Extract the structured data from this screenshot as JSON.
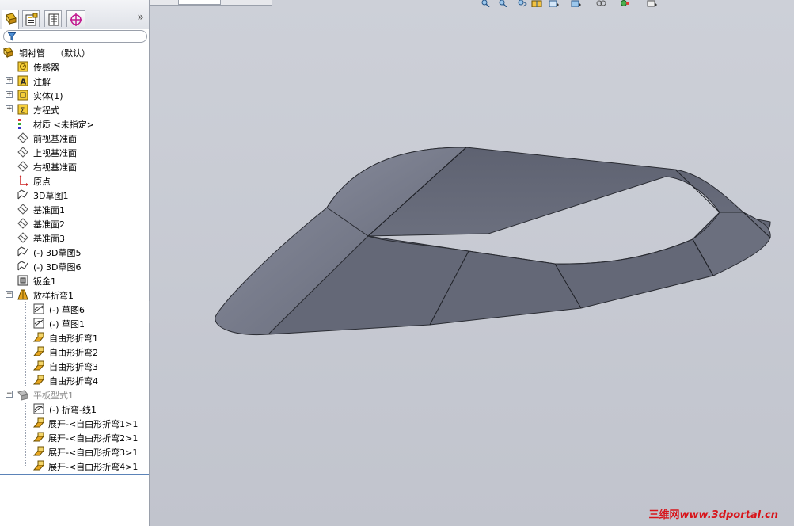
{
  "panel": {
    "tabs": [
      {
        "icon": "feature-manager-icon"
      },
      {
        "icon": "property-manager-icon"
      },
      {
        "icon": "configuration-manager-icon"
      },
      {
        "icon": "dimxpert-manager-icon"
      }
    ],
    "expand": "»"
  },
  "tree": {
    "root": {
      "name": "钢衬管",
      "config": "（默认）"
    },
    "items": [
      {
        "label": "传感器",
        "icon": "sensors-icon"
      },
      {
        "label": "注解",
        "icon": "annotations-icon"
      },
      {
        "label": "实体(1)",
        "icon": "solid-bodies-icon"
      },
      {
        "label": "方程式",
        "icon": "equations-icon"
      },
      {
        "label": "材质 <未指定>",
        "icon": "material-icon"
      },
      {
        "label": "前视基准面",
        "icon": "plane-icon"
      },
      {
        "label": "上视基准面",
        "icon": "plane-icon"
      },
      {
        "label": "右视基准面",
        "icon": "plane-icon"
      },
      {
        "label": "原点",
        "icon": "origin-icon"
      },
      {
        "label": "3D草图1",
        "icon": "sketch-3d-icon"
      },
      {
        "label": "基准面1",
        "icon": "plane-icon"
      },
      {
        "label": "基准面2",
        "icon": "plane-icon"
      },
      {
        "label": "基准面3",
        "icon": "plane-icon"
      },
      {
        "label": "(-) 3D草图5",
        "icon": "sketch-3d-icon"
      },
      {
        "label": "(-) 3D草图6",
        "icon": "sketch-3d-icon"
      },
      {
        "label": "钣金1",
        "icon": "sheet-metal-icon"
      },
      {
        "label": "放样折弯1",
        "icon": "lofted-bend-icon"
      },
      {
        "label": "(-) 草图6",
        "icon": "sketch-icon"
      },
      {
        "label": "(-) 草图1",
        "icon": "sketch-icon"
      },
      {
        "label": "自由形折弯1",
        "icon": "freeform-bend-icon"
      },
      {
        "label": "自由形折弯2",
        "icon": "freeform-bend-icon"
      },
      {
        "label": "自由形折弯3",
        "icon": "freeform-bend-icon"
      },
      {
        "label": "自由形折弯4",
        "icon": "freeform-bend-icon"
      },
      {
        "label": "平板型式1",
        "icon": "flat-pattern-icon"
      },
      {
        "label": "(-) 折弯-线1",
        "icon": "sketch-icon"
      },
      {
        "label": "展开-<自由形折弯1>1",
        "icon": "freeform-bend-icon"
      },
      {
        "label": "展开-<自由形折弯2>1",
        "icon": "freeform-bend-icon"
      },
      {
        "label": "展开-<自由形折弯3>1",
        "icon": "freeform-bend-icon"
      },
      {
        "label": "展开-<自由形折弯4>1",
        "icon": "freeform-bend-icon"
      }
    ]
  },
  "viewport": {
    "heads_up_icons": [
      "zoom-to-fit-icon",
      "zoom-area-icon",
      "previous-view-icon",
      "section-view-icon",
      "view-orientation-icon",
      "display-style-icon",
      "hide-show-items-icon",
      "edit-appearance-icon",
      "apply-scene-icon"
    ],
    "watermark_cn": "三维网",
    "watermark_url": "www.3dportal.cn"
  },
  "colors": {
    "part_face": "#646877",
    "part_light": "#767a89",
    "viewport_bg": "#c4c7d0",
    "watermark": "#d8141a"
  }
}
